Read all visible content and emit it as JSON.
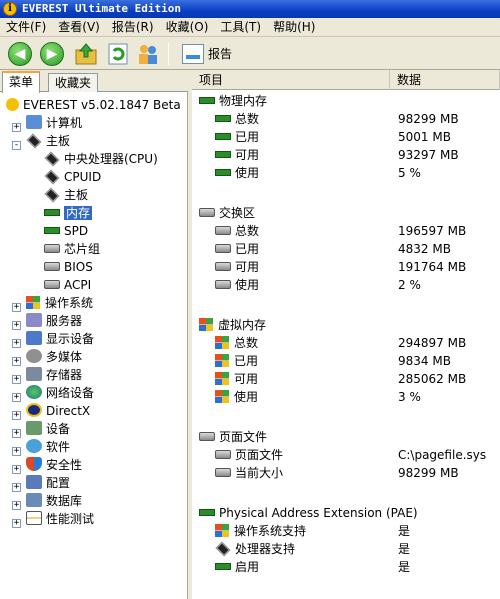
{
  "window": {
    "title": "EVEREST Ultimate Edition"
  },
  "menu": [
    "文件(F)",
    "查看(V)",
    "报告(R)",
    "收藏(O)",
    "工具(T)",
    "帮助(H)"
  ],
  "toolbar": {
    "report_label": "报告"
  },
  "left_tabs": [
    "菜单",
    "收藏夹"
  ],
  "tree": {
    "root": "EVEREST v5.02.1847 Beta",
    "computer": "计算机",
    "motherboard": "主板",
    "mb_children": [
      "中央处理器(CPU)",
      "CPUID",
      "主板",
      "内存",
      "SPD",
      "芯片组",
      "BIOS",
      "ACPI"
    ],
    "others": [
      "操作系统",
      "服务器",
      "显示设备",
      "多媒体",
      "存储器",
      "网络设备",
      "DirectX",
      "设备",
      "软件",
      "安全性",
      "配置",
      "数据库",
      "性能测试"
    ]
  },
  "columns": {
    "item": "项目",
    "value": "数据"
  },
  "sections": [
    {
      "title": "物理内存",
      "icon": "memory-icon",
      "rows": [
        [
          "总数",
          "98299 MB"
        ],
        [
          "已用",
          "5001 MB"
        ],
        [
          "可用",
          "93297 MB"
        ],
        [
          "使用",
          "5 %"
        ]
      ]
    },
    {
      "title": "交换区",
      "icon": "swap-icon",
      "rows": [
        [
          "总数",
          "196597 MB"
        ],
        [
          "已用",
          "4832 MB"
        ],
        [
          "可用",
          "191764 MB"
        ],
        [
          "使用",
          "2 %"
        ]
      ]
    },
    {
      "title": "虚拟内存",
      "icon": "windows-icon",
      "rows": [
        [
          "总数",
          "294897 MB"
        ],
        [
          "已用",
          "9834 MB"
        ],
        [
          "可用",
          "285062 MB"
        ],
        [
          "使用",
          "3 %"
        ]
      ]
    },
    {
      "title": "页面文件",
      "icon": "swap-icon",
      "rows": [
        [
          "页面文件",
          "C:\\pagefile.sys"
        ],
        [
          "当前大小",
          "98299 MB"
        ]
      ]
    },
    {
      "title": "Physical Address Extension (PAE)",
      "icon": "memory-icon",
      "rows": [
        [
          "操作系统支持",
          "是"
        ],
        [
          "处理器支持",
          "是"
        ],
        [
          "启用",
          "是"
        ]
      ]
    }
  ]
}
